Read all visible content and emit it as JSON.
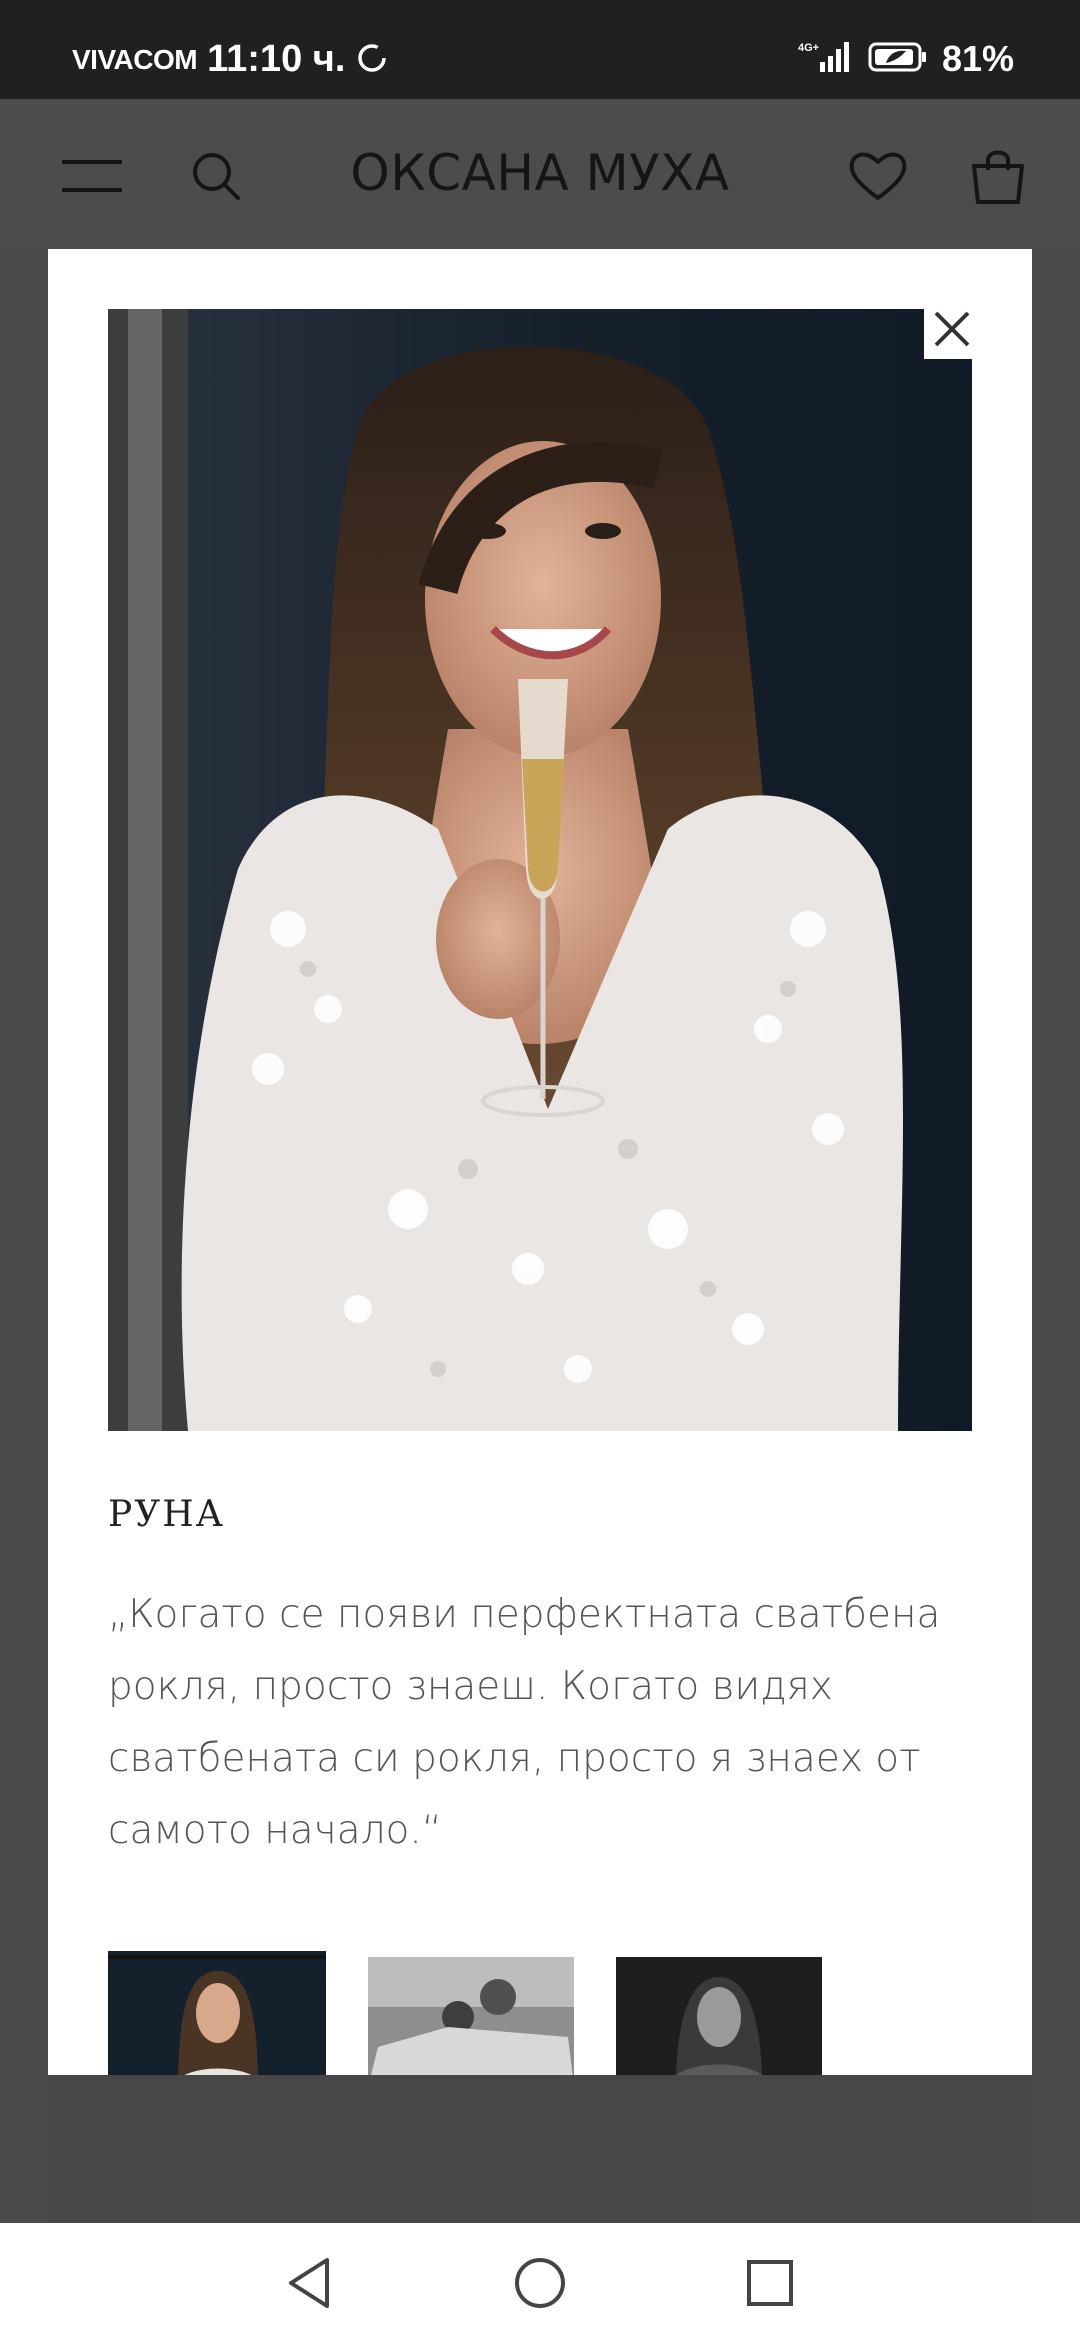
{
  "status_bar": {
    "carrier": "VIVACOM",
    "time": "11:10 ч.",
    "network": "4G+",
    "battery": "81%"
  },
  "header": {
    "brand": "ОКСАНА МУХА",
    "icons": [
      "menu-icon",
      "search-icon",
      "heart-icon",
      "bag-icon"
    ]
  },
  "testimonial": {
    "name": "РУНА",
    "quote": "„Когато се появи перфектната сватбена рокля, просто знаеш. Когато видях сватбената си рокля, просто я знаех от самото начало.“",
    "thumbnails_count": 3
  },
  "navigation": {
    "icons": [
      "back-icon",
      "home-icon",
      "recent-apps-icon"
    ]
  }
}
